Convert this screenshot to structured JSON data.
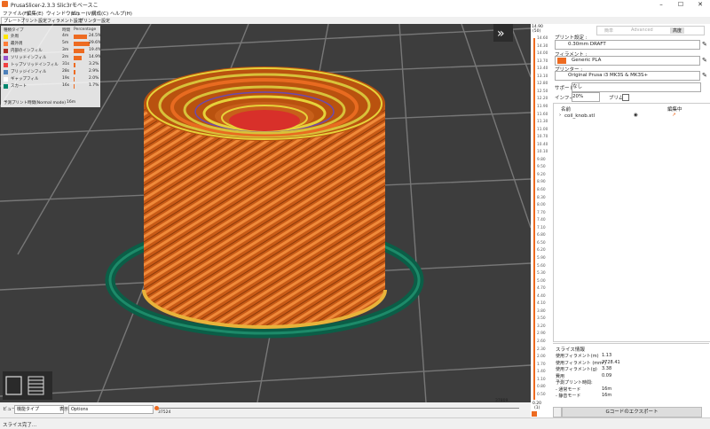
{
  "app": {
    "title": "PrusaSlicer-2.3.3 Slic3rモベースこ"
  },
  "menu": [
    "ファイル(F)",
    "編集(E)",
    "ウィンドウ(W)",
    "ビュー(V)",
    "構成(C)",
    "ヘルプ(H)"
  ],
  "tabs": [
    "プレート",
    "プリント設定",
    "フィラメント設定",
    "プリンター設定"
  ],
  "legend": {
    "headers": {
      "type": "種類タイプ",
      "time": "時間",
      "percentage": "Percentage"
    },
    "rows": [
      {
        "name": "外周",
        "time": "4m",
        "pct": "24.5%",
        "color": "#ffe600",
        "frac": 0.245
      },
      {
        "name": "最外周",
        "time": "5m",
        "pct": "29.6%",
        "color": "#ff7d38",
        "frac": 0.296
      },
      {
        "name": "内部のインフィル",
        "time": "3m",
        "pct": "19.4%",
        "color": "#b03029",
        "frac": 0.194
      },
      {
        "name": "ソリッドインフィル",
        "time": "2m",
        "pct": "14.9%",
        "color": "#9654cc",
        "frac": 0.149
      },
      {
        "name": "トップソリッドインフィル",
        "time": "31s",
        "pct": "3.2%",
        "color": "#f04040",
        "frac": 0.032
      },
      {
        "name": "ブリッジインフィル",
        "time": "28s",
        "pct": "2.9%",
        "color": "#4d80ba",
        "frac": 0.029
      },
      {
        "name": "ギャップフィル",
        "time": "19s",
        "pct": "2.0%",
        "color": "#ffffff",
        "frac": 0.02
      },
      {
        "name": "スカート",
        "time": "16s",
        "pct": "1.7%",
        "color": "#00876e",
        "frac": 0.017
      }
    ],
    "estimate_label": "予測プリント時間(Normal mode)",
    "estimate_value": "16m"
  },
  "bottom": {
    "view_label": "ビュー",
    "view_value": "機能タイプ",
    "show_label": "表示",
    "show_value": "Options",
    "h_left": "37524",
    "h_right": "37809"
  },
  "vslider": {
    "top_value": "14.90",
    "top_index": "(50)",
    "bottom_value": "0.20",
    "bottom_index": "(1)",
    "ticks": [
      "14.60",
      "14.30",
      "14.00",
      "13.70",
      "13.40",
      "13.10",
      "12.80",
      "12.50",
      "12.20",
      "11.90",
      "11.60",
      "11.30",
      "11.00",
      "10.70",
      "10.40",
      "10.10",
      "9.80",
      "9.50",
      "9.20",
      "8.90",
      "8.60",
      "8.30",
      "8.00",
      "7.70",
      "7.40",
      "7.10",
      "6.80",
      "6.50",
      "6.20",
      "5.90",
      "5.60",
      "5.30",
      "5.00",
      "4.70",
      "4.40",
      "4.10",
      "3.80",
      "3.50",
      "3.20",
      "2.90",
      "2.60",
      "2.30",
      "2.00",
      "1.70",
      "1.40",
      "1.10",
      "0.80",
      "0.50"
    ]
  },
  "right": {
    "modes": [
      "簡単",
      "Advanced",
      "高度"
    ],
    "print_label": "プリント設定 :",
    "print_value": "0.30mm DRAFT",
    "filament_label": "フィラメント :",
    "filament_value": "Generic PLA",
    "filament_color": "#ed6b21",
    "printer_label": "プリンター :",
    "printer_value": "Original Prusa i3 MK3S & MK3S+",
    "support_label": "サポート:",
    "support_value": "なし",
    "infill_label": "インフィル:",
    "infill_value": "20%",
    "brim_label": "ブリム:",
    "col_name": "名前",
    "col_edit": "編集中",
    "object": "coil_knob.stl",
    "slice_info_title": "スライス情報",
    "slice_info": [
      {
        "k": "使用フィラメント(m)",
        "v": "1.13"
      },
      {
        "k": "使用フィラメント (mm³)",
        "v": "2728.41"
      },
      {
        "k": "使用フィラメント(g)",
        "v": "3.38"
      },
      {
        "k": "費用",
        "v": "0.09"
      },
      {
        "k": "予測プリント時間:",
        "v": ""
      },
      {
        "k": " - 通常モード",
        "v": "16m"
      },
      {
        "k": " - 静音モード",
        "v": "16m"
      }
    ],
    "export_label": "Gコードのエクスポート"
  },
  "status": "スライス完了..."
}
